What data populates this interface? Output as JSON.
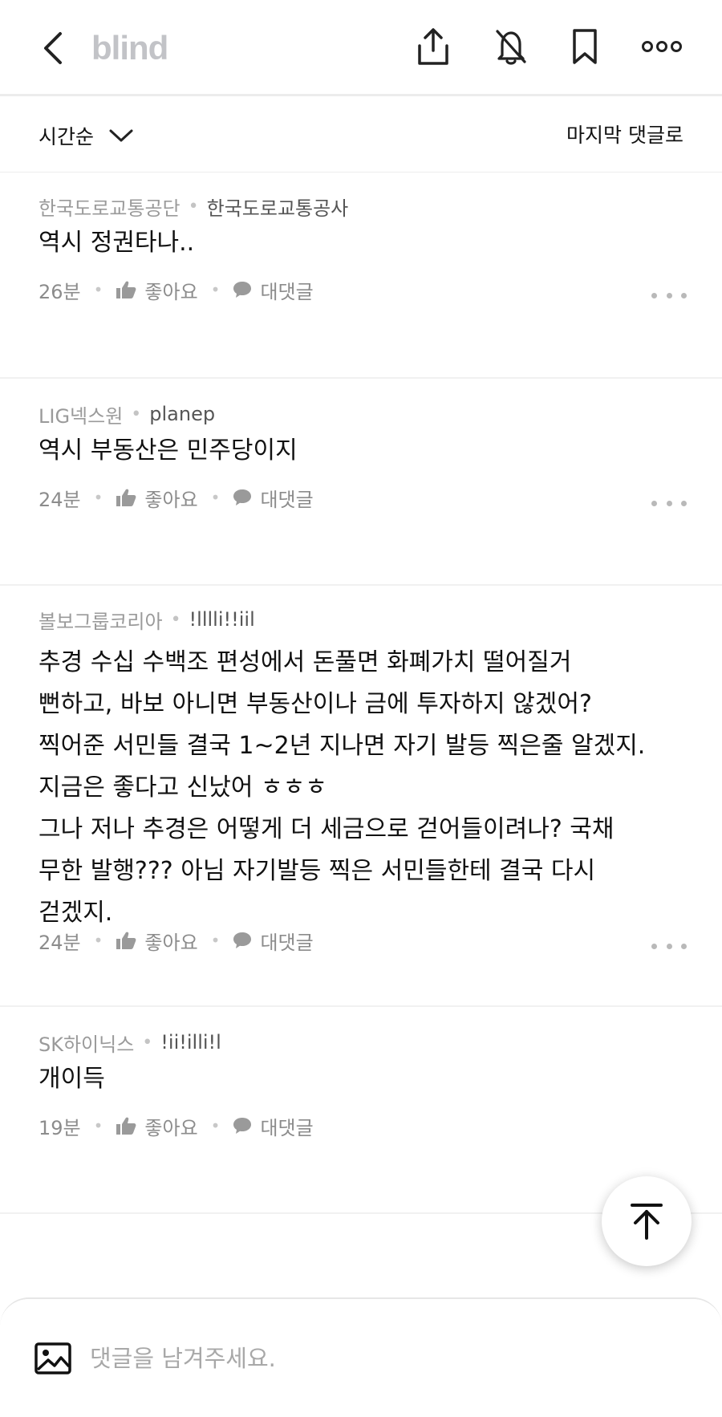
{
  "header": {
    "logo": "blind",
    "icons": [
      "back-icon",
      "share-icon",
      "notifications-off-icon",
      "bookmark-icon",
      "more-icon"
    ]
  },
  "sortbar": {
    "sort_label": "시간순",
    "last_comment_label": "마지막 댓글로"
  },
  "comments": [
    {
      "company": "한국도로교통공단",
      "nickname": "한국도로교통공사",
      "text": "역시 정권타나..",
      "time": "26분",
      "like_label": "좋아요",
      "reply_label": "대댓글"
    },
    {
      "company": "LIG넥스원",
      "nickname": "planep",
      "text": "역시 부동산은 민주당이지",
      "time": "24분",
      "like_label": "좋아요",
      "reply_label": "대댓글"
    },
    {
      "company": "볼보그룹코리아",
      "nickname": "!lllli!!iil",
      "text": "추경 수십 수백조 편성에서 돈풀면 화폐가치 떨어질거\n뻔하고, 바보 아니면 부동산이나 금에 투자하지 않겠어?\n찍어준 서민들 결국 1~2년 지나면 자기 발등 찍은줄 알겠지.\n지금은 좋다고 신났어 ㅎㅎㅎ\n그나 저나 추경은 어떻게 더 세금으로 걷어들이려나? 국채\n무한 발행???  아님 자기발등 찍은 서민들한테 결국 다시\n걷겠지.",
      "time": "24분",
      "like_label": "좋아요",
      "reply_label": "대댓글"
    },
    {
      "company": "SK하이닉스",
      "nickname": "!ii!illi!l",
      "text": "개이득",
      "time": "19분",
      "like_label": "좋아요",
      "reply_label": "대댓글"
    }
  ],
  "composer": {
    "placeholder": "댓글을 남겨주세요.",
    "value": ""
  },
  "colors": {
    "logo": "#c2c3c7",
    "meta_gray": "#9a9a9a",
    "divider": "#ececec"
  }
}
